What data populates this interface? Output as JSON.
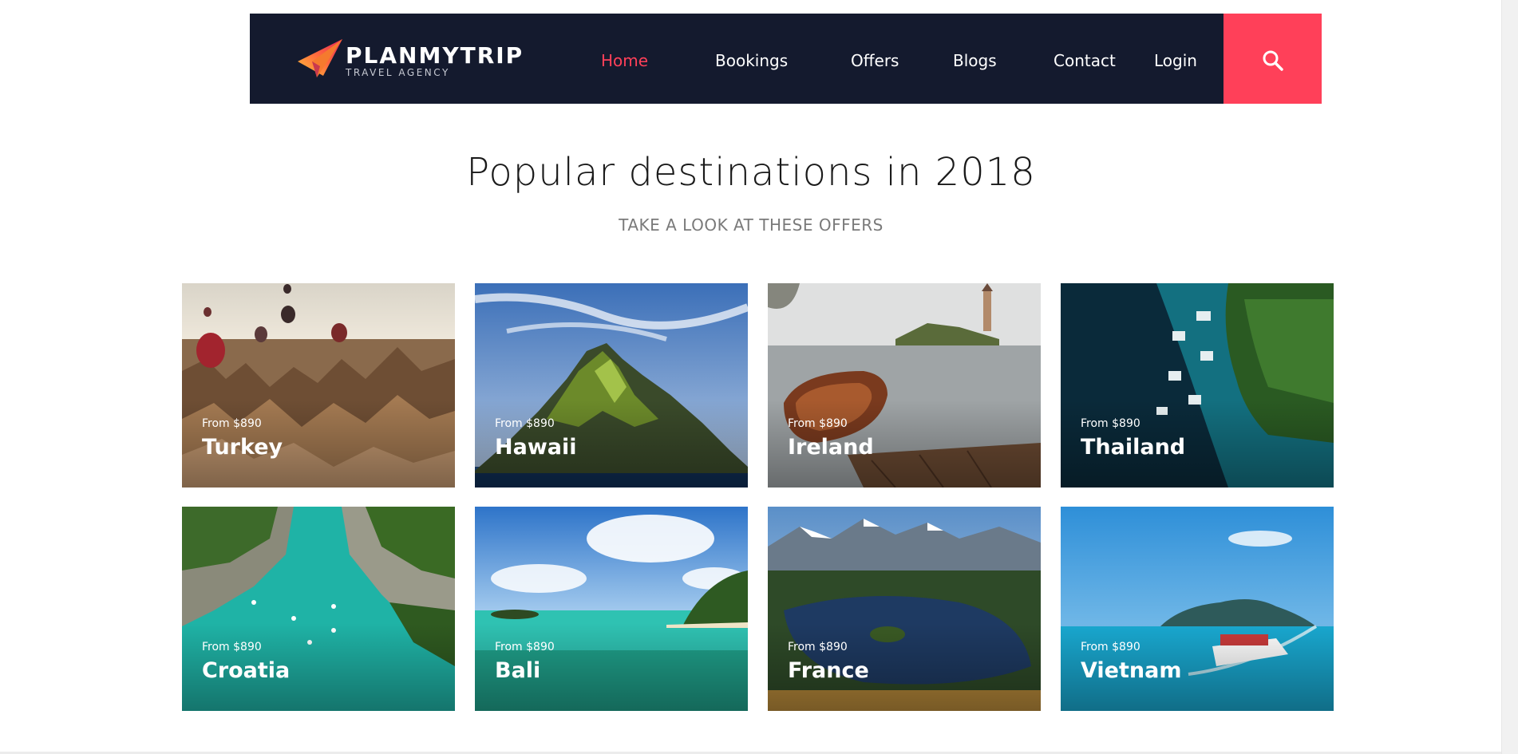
{
  "brand": {
    "name": "PLANMYTRIP",
    "tagline": "TRAVEL AGENCY",
    "accent_color": "#ff4059",
    "nav_bg_color": "#141a2e"
  },
  "nav": {
    "items": [
      {
        "label": "Home",
        "active": true
      },
      {
        "label": "Bookings",
        "active": false
      },
      {
        "label": "Offers",
        "active": false
      },
      {
        "label": "Blogs",
        "active": false
      },
      {
        "label": "Contact",
        "active": false
      },
      {
        "label": "Login",
        "active": false
      }
    ],
    "search_icon": "search-icon"
  },
  "section": {
    "title": "Popular destinations in 2018",
    "subtitle": "TAKE A LOOK AT THESE OFFERS"
  },
  "destinations": [
    {
      "name": "Turkey",
      "price": "From $890"
    },
    {
      "name": "Hawaii",
      "price": "From $890"
    },
    {
      "name": "Ireland",
      "price": "From $890"
    },
    {
      "name": "Thailand",
      "price": "From $890"
    },
    {
      "name": "Croatia",
      "price": "From $890"
    },
    {
      "name": "Bali",
      "price": "From $890"
    },
    {
      "name": "France",
      "price": "From $890"
    },
    {
      "name": "Vietnam",
      "price": "From $890"
    }
  ]
}
